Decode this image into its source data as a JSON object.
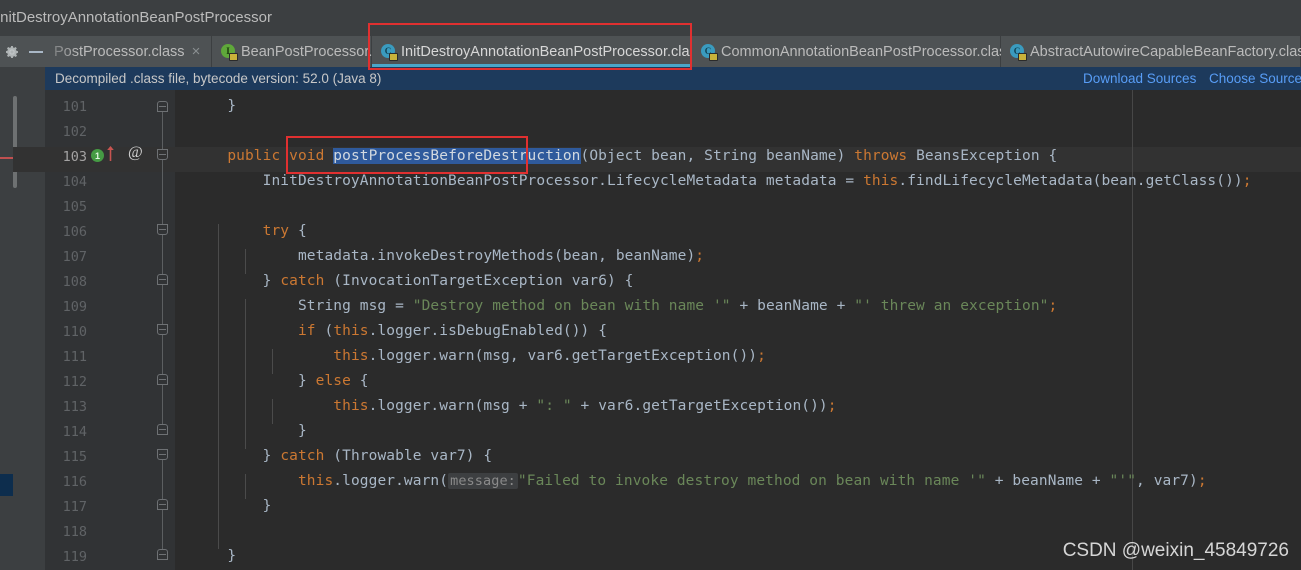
{
  "window": {
    "breadcrumb": "InitDestroyAnnotationBeanPostProcessor"
  },
  "toolbar": {
    "settings_icon": "gear-icon",
    "collapse_icon": "minus-icon"
  },
  "tabs": [
    {
      "label": "PostProcessor.class",
      "icon": "class-icon",
      "active": false,
      "close": "×"
    },
    {
      "label": "BeanPostProcessor.class",
      "icon": "interface-icon",
      "active": false,
      "close": "×"
    },
    {
      "label": "InitDestroyAnnotationBeanPostProcessor.class",
      "icon": "class-icon",
      "active": true,
      "close": "×"
    },
    {
      "label": "CommonAnnotationBeanPostProcessor.class",
      "icon": "class-icon",
      "active": false,
      "close": "×"
    },
    {
      "label": "AbstractAutowireCapableBeanFactory.class",
      "icon": "class-icon",
      "active": false,
      "close": "×"
    }
  ],
  "notice": {
    "text": "Decompiled .class file, bytecode version: 52.0 (Java 8)",
    "download_link": "Download Sources",
    "choose_link": "Choose Source",
    "background": "#1d3a5c",
    "link_color": "#589df6"
  },
  "gutter": {
    "first_line": 101,
    "last_line": 119,
    "current_line": 103,
    "marker_badge": "1",
    "annotation_glyph": "@"
  },
  "editor": {
    "selected_text": "postProcessBeforeDestruction",
    "inlay_hint": "message:",
    "lines": [
      {
        "n": 101,
        "indent": 0
      },
      {
        "n": 102,
        "indent": 0
      },
      {
        "n": 103,
        "indent": 0
      },
      {
        "n": 104,
        "indent": 0
      },
      {
        "n": 105,
        "indent": 0
      },
      {
        "n": 106,
        "indent": 0
      },
      {
        "n": 107,
        "indent": 0
      },
      {
        "n": 108,
        "indent": 0
      },
      {
        "n": 109,
        "indent": 0
      },
      {
        "n": 110,
        "indent": 0
      },
      {
        "n": 111,
        "indent": 0
      },
      {
        "n": 112,
        "indent": 0
      },
      {
        "n": 113,
        "indent": 0
      },
      {
        "n": 114,
        "indent": 0
      },
      {
        "n": 115,
        "indent": 0
      },
      {
        "n": 116,
        "indent": 0
      },
      {
        "n": 117,
        "indent": 0
      },
      {
        "n": 118,
        "indent": 0
      },
      {
        "n": 119,
        "indent": 0
      }
    ],
    "code": {
      "l101": "    }",
      "l103_pre": "    public void ",
      "l103_sel": "postProcessBeforeDestruction",
      "l103_post": "(Object bean, String beanName) ",
      "l103_kw": "throws",
      "l103_tail": " BeansException {",
      "l104": "        InitDestroyAnnotationBeanPostProcessor.LifecycleMetadata metadata = this.findLifecycleMetadata(bean.getClass());",
      "l106": "        try {",
      "l107": "            metadata.invokeDestroyMethods(bean, beanName);",
      "l108": "        } catch (InvocationTargetException var6) {",
      "l109": "            String msg = \"Destroy method on bean with name '\" + beanName + \"' threw an exception\";",
      "l110": "            if (this.logger.isDebugEnabled()) {",
      "l111": "                this.logger.warn(msg, var6.getTargetException());",
      "l112": "            } else {",
      "l113": "                this.logger.warn(msg + \": \" + var6.getTargetException());",
      "l114": "            }",
      "l115": "        } catch (Throwable var7) {",
      "l116": "            this.logger.warn( message: \"Failed to invoke destroy method on bean with name '\" + beanName + \"'\", var7);",
      "l117": "        }",
      "l119": "    }"
    }
  },
  "annotations": {
    "tab_highlight_color": "#e03030",
    "method_highlight_color": "#e03030"
  },
  "watermark": {
    "text": "CSDN @weixin_45849726"
  },
  "colors": {
    "background": "#2b2b2b",
    "chrome": "#3c3f41",
    "tab_bg": "#4e5254",
    "keyword": "#cc7832",
    "string": "#6a8759",
    "text": "#a9b7c6",
    "line_number": "#606366",
    "selection": "#2f5a9c",
    "active_tab_underline": "#4ba6c9"
  }
}
